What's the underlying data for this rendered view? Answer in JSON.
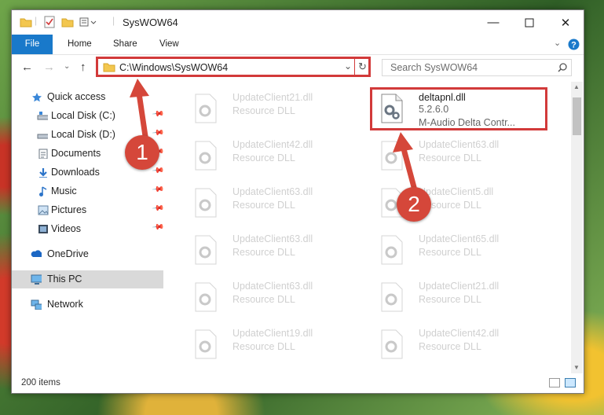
{
  "window": {
    "title": "SysWOW64"
  },
  "ribbon": {
    "tabs": [
      "File",
      "Home",
      "Share",
      "View"
    ]
  },
  "address": {
    "path": "C:\\Windows\\SysWOW64",
    "search_placeholder": "Search SysWOW64"
  },
  "nav": {
    "quick_access": "Quick access",
    "items": [
      {
        "label": "Local Disk (C:)",
        "icon": "drive-icon",
        "pinned": true
      },
      {
        "label": "Local Disk (D:)",
        "icon": "drive-icon",
        "pinned": true
      },
      {
        "label": "Documents",
        "icon": "documents-icon",
        "pinned": true
      },
      {
        "label": "Downloads",
        "icon": "downloads-icon",
        "pinned": true
      },
      {
        "label": "Music",
        "icon": "music-icon",
        "pinned": true
      },
      {
        "label": "Pictures",
        "icon": "pictures-icon",
        "pinned": true
      },
      {
        "label": "Videos",
        "icon": "videos-icon",
        "pinned": true
      }
    ],
    "onedrive": "OneDrive",
    "this_pc": "This PC",
    "network": "Network"
  },
  "files": {
    "left": [
      {
        "name": "UpdateClient21.dll",
        "type": "Resource DLL"
      },
      {
        "name": "UpdateClient42.dll",
        "type": "Resource DLL"
      },
      {
        "name": "UpdateClient63.dll",
        "type": "Resource DLL"
      },
      {
        "name": "UpdateClient63.dll",
        "type": "Resource DLL"
      },
      {
        "name": "UpdateClient63.dll",
        "type": "Resource DLL"
      },
      {
        "name": "UpdateClient19.dll",
        "type": "Resource DLL"
      }
    ],
    "right": [
      {
        "name": "deltapnl.dll",
        "version": "5.2.6.0",
        "description": "M-Audio Delta Contr..."
      },
      {
        "name": "UpdateClient63.dll",
        "type": "Resource DLL"
      },
      {
        "name": "UpdateClient5.dll",
        "type": "Resource DLL"
      },
      {
        "name": "UpdateClient65.dll",
        "type": "Resource DLL"
      },
      {
        "name": "UpdateClient21.dll",
        "type": "Resource DLL"
      },
      {
        "name": "UpdateClient42.dll",
        "type": "Resource DLL"
      }
    ]
  },
  "status": {
    "item_count": "200 items"
  },
  "callouts": [
    "1",
    "2"
  ],
  "colors": {
    "accent": "#1979ca",
    "highlight": "#d23a3a",
    "callout": "#d5473a",
    "selected_nav": "#d9d9d9"
  }
}
